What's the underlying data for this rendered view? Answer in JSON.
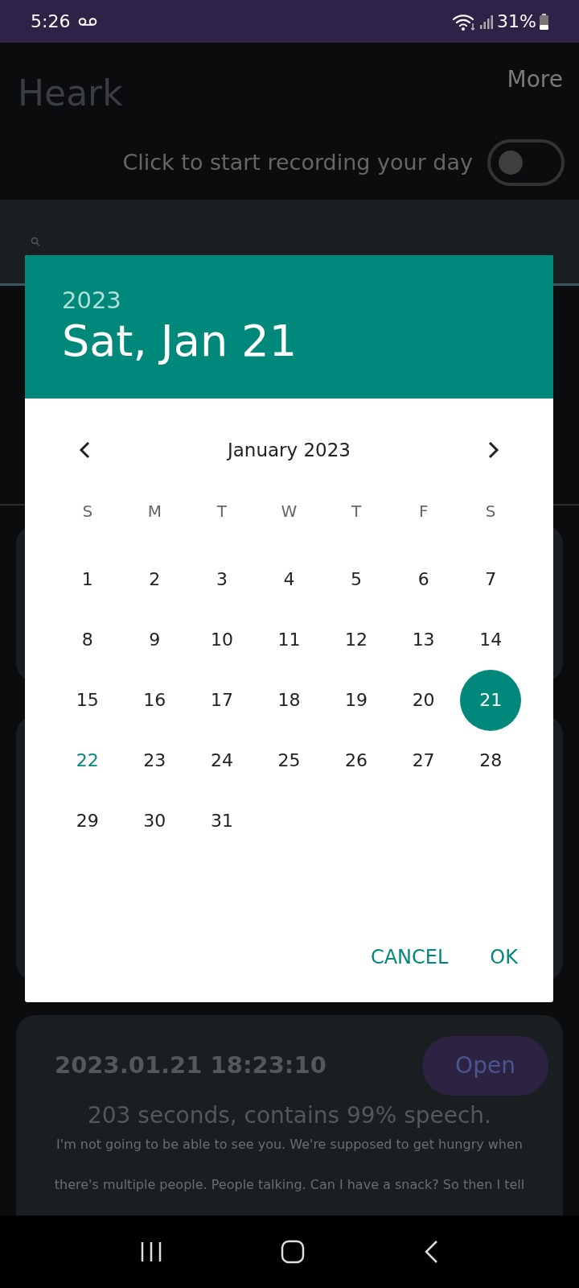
{
  "status_bar": {
    "time": "5:26",
    "battery": "31%"
  },
  "app": {
    "title": "Heark",
    "more": "More",
    "record_label": "Click to start recording your day",
    "record_toggle": {
      "on": false
    }
  },
  "recording": {
    "timestamp": "2023.01.21 18:23:10",
    "open_button": "Open",
    "summary": "203 seconds, contains 99% speech.",
    "transcript": "I'm not going to be able to see you. We're supposed to get hungry when there's multiple people. People talking. Can I have a snack? So then I tell"
  },
  "date_picker": {
    "year": "2023",
    "date": "Sat, Jan 21",
    "month": "January 2023",
    "weekdays": [
      "S",
      "M",
      "T",
      "W",
      "T",
      "F",
      "S"
    ],
    "days": [
      {
        "label": "1",
        "selected": false,
        "today": false
      },
      {
        "label": "2",
        "selected": false,
        "today": false
      },
      {
        "label": "3",
        "selected": false,
        "today": false
      },
      {
        "label": "4",
        "selected": false,
        "today": false
      },
      {
        "label": "5",
        "selected": false,
        "today": false
      },
      {
        "label": "6",
        "selected": false,
        "today": false
      },
      {
        "label": "7",
        "selected": false,
        "today": false
      },
      {
        "label": "8",
        "selected": false,
        "today": false
      },
      {
        "label": "9",
        "selected": false,
        "today": false
      },
      {
        "label": "10",
        "selected": false,
        "today": false
      },
      {
        "label": "11",
        "selected": false,
        "today": false
      },
      {
        "label": "12",
        "selected": false,
        "today": false
      },
      {
        "label": "13",
        "selected": false,
        "today": false
      },
      {
        "label": "14",
        "selected": false,
        "today": false
      },
      {
        "label": "15",
        "selected": false,
        "today": false
      },
      {
        "label": "16",
        "selected": false,
        "today": false
      },
      {
        "label": "17",
        "selected": false,
        "today": false
      },
      {
        "label": "18",
        "selected": false,
        "today": false
      },
      {
        "label": "19",
        "selected": false,
        "today": false
      },
      {
        "label": "20",
        "selected": false,
        "today": false
      },
      {
        "label": "21",
        "selected": true,
        "today": false
      },
      {
        "label": "22",
        "selected": false,
        "today": true
      },
      {
        "label": "23",
        "selected": false,
        "today": false
      },
      {
        "label": "24",
        "selected": false,
        "today": false
      },
      {
        "label": "25",
        "selected": false,
        "today": false
      },
      {
        "label": "26",
        "selected": false,
        "today": false
      },
      {
        "label": "27",
        "selected": false,
        "today": false
      },
      {
        "label": "28",
        "selected": false,
        "today": false
      },
      {
        "label": "29",
        "selected": false,
        "today": false
      },
      {
        "label": "30",
        "selected": false,
        "today": false
      },
      {
        "label": "31",
        "selected": false,
        "today": false
      }
    ],
    "buttons": [
      "CANCEL",
      "OK"
    ]
  }
}
